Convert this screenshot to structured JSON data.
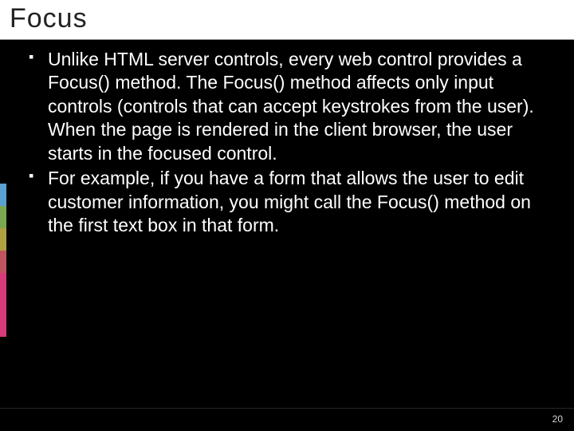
{
  "title": "Focus",
  "bullets": [
    "Unlike HTML server controls, every web control provides a Focus() method. The Focus() method affects only input controls (controls that can accept keystrokes from the user). When the page is rendered in the client browser, the user starts in the focused control.",
    "For example, if you have a form that allows the user to edit customer information, you might call the Focus() method on the first text box in that form."
  ],
  "page_number": "20"
}
